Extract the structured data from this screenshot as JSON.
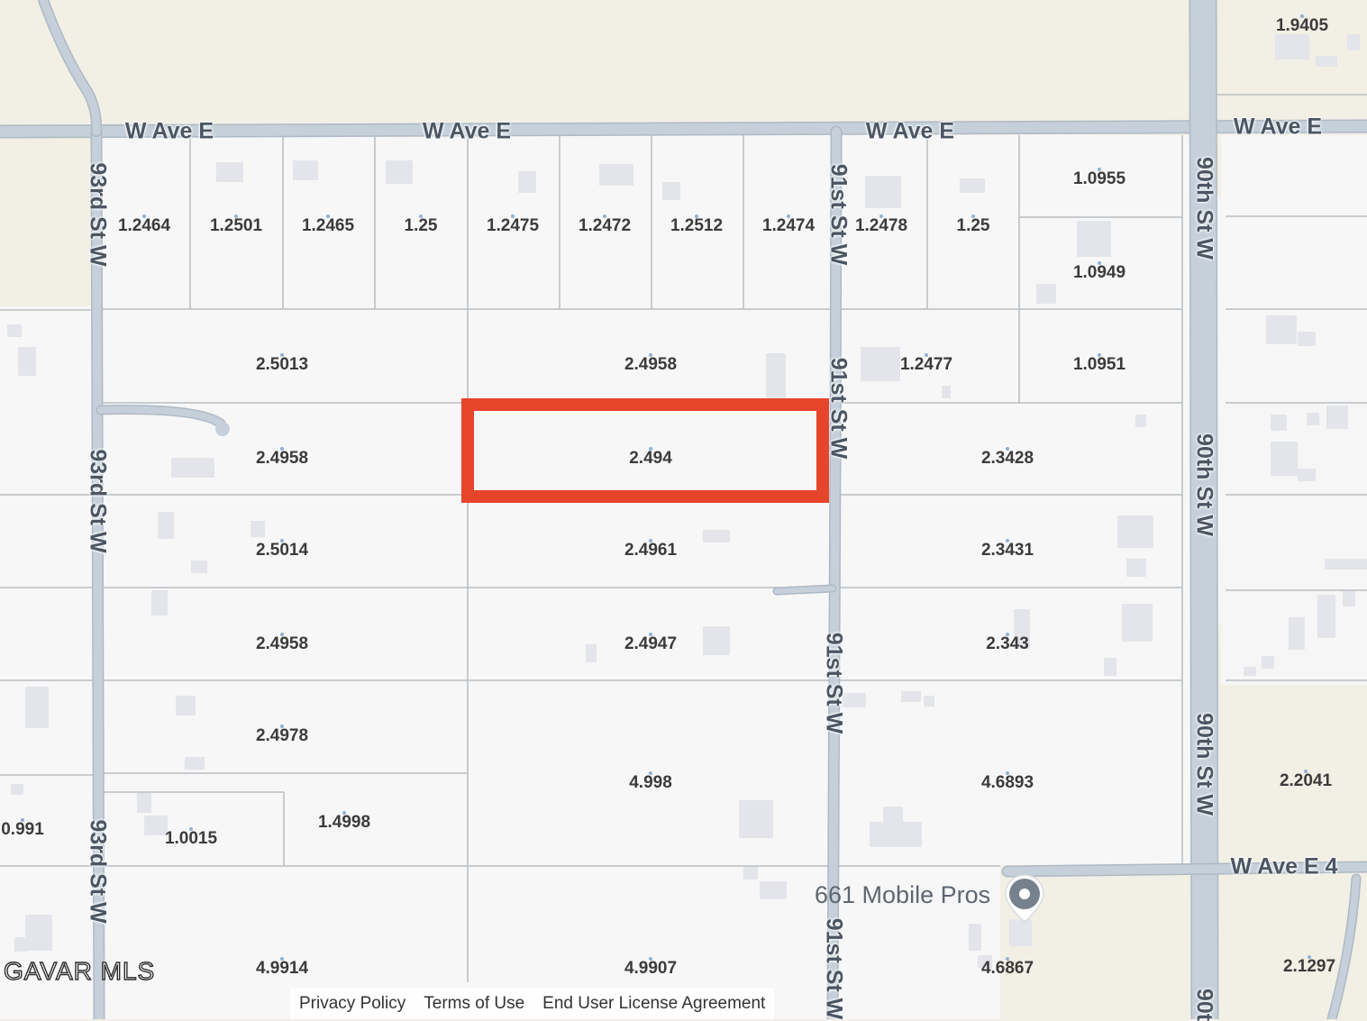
{
  "map": {
    "colors": {
      "background": "#f2efe5",
      "parcel_fill": "#f7f7f7",
      "parcel_line": "#b9bdc2",
      "road": "#c5d0da",
      "road_edge": "#aeb9c4",
      "building": "#e4e5ea",
      "highlight": "#e6452b"
    },
    "streets": [
      {
        "id": "w-ave-e-1",
        "label": "W Ave E"
      },
      {
        "id": "w-ave-e-2",
        "label": "W Ave E"
      },
      {
        "id": "w-ave-e-3",
        "label": "W Ave E"
      },
      {
        "id": "w-ave-e-4",
        "label": "W Ave E"
      },
      {
        "id": "93rd-1",
        "label": "93rd St W"
      },
      {
        "id": "93rd-2",
        "label": "93rd St W"
      },
      {
        "id": "93rd-3",
        "label": "93rd St W"
      },
      {
        "id": "91st-1",
        "label": "91st St W"
      },
      {
        "id": "91st-2",
        "label": "91st St W"
      },
      {
        "id": "91st-3",
        "label": "91st St W"
      },
      {
        "id": "91st-4",
        "label": "91st St W"
      },
      {
        "id": "90th-1",
        "label": "90th St W"
      },
      {
        "id": "90th-2",
        "label": "90th St W"
      },
      {
        "id": "90th-3",
        "label": "90th St W"
      },
      {
        "id": "90th-4",
        "label": "90t"
      },
      {
        "id": "w-ave-e4",
        "label": "W Ave E 4"
      }
    ],
    "parcels": [
      "1.9405",
      "1.2464",
      "1.2501",
      "1.2465",
      "1.25",
      "1.2475",
      "1.2472",
      "1.2512",
      "1.2474",
      "1.2478",
      "1.25",
      "1.0955",
      "1.0949",
      "2.5013",
      "2.4958",
      "1.2477",
      "1.0951",
      "2.4958",
      "2.494",
      "2.3428",
      "2.5014",
      "2.4961",
      "2.3431",
      "2.4958",
      "2.4947",
      "2.343",
      "2.4978",
      "4.998",
      "4.6893",
      "2.2041",
      "0.991",
      "1.0015",
      "1.4998",
      "4.9914",
      "4.9907",
      "4.6867",
      "2.1297"
    ],
    "selected_parcel": "2.494",
    "poi": {
      "name": "661 Mobile Pros",
      "icon": "map-pin-icon"
    },
    "watermark": "GAVAR MLS"
  },
  "footer": {
    "privacy": "Privacy Policy",
    "terms": "Terms of Use",
    "eula": "End User License Agreement"
  }
}
